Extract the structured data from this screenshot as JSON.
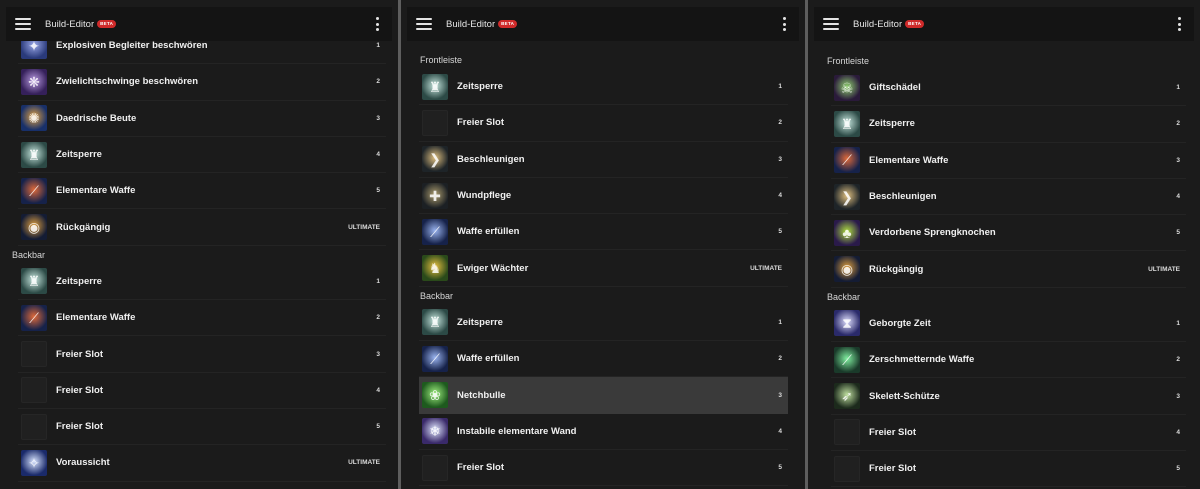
{
  "colors": {
    "background": "#1b1b1b",
    "appbar": "#141414",
    "beta_badge": "#d02a2a",
    "selected_row": "#3a3a3a"
  },
  "panels": [
    {
      "appbar": {
        "title": "Build-Editor",
        "badge": "BETA"
      },
      "sections": [
        {
          "title": "",
          "items": [
            {
              "name": "Explosiven Begleiter beschwören",
              "slot": "1",
              "icon": "explosive-companion-icon",
              "color1": "#2a3a7a",
              "color2": "#9aa8e8",
              "glyph": "✦"
            },
            {
              "name": "Zwielichtschwinge beschwören",
              "slot": "2",
              "icon": "twilight-matriarch-icon",
              "color1": "#35205a",
              "color2": "#b89ae0",
              "glyph": "❋"
            },
            {
              "name": "Daedrische Beute",
              "slot": "3",
              "icon": "daedric-prey-icon",
              "color1": "#18306a",
              "color2": "#e0a040",
              "glyph": "✺"
            },
            {
              "name": "Zeitsperre",
              "slot": "4",
              "icon": "time-stop-icon",
              "color1": "#2c4a46",
              "color2": "#c8e8e0",
              "glyph": "♜"
            },
            {
              "name": "Elementare Waffe",
              "slot": "5",
              "icon": "elemental-weapon-icon",
              "color1": "#16224a",
              "color2": "#e06a3a",
              "glyph": "⟋"
            },
            {
              "name": "Rückgängig",
              "slot": "ULTIMATE",
              "icon": "undo-icon",
              "color1": "#141c34",
              "color2": "#e0a040",
              "glyph": "◉"
            }
          ]
        },
        {
          "title": "Backbar",
          "items": [
            {
              "name": "Zeitsperre",
              "slot": "1",
              "icon": "time-stop-icon",
              "color1": "#2c4a46",
              "color2": "#c8e8e0",
              "glyph": "♜"
            },
            {
              "name": "Elementare Waffe",
              "slot": "2",
              "icon": "elemental-weapon-icon",
              "color1": "#16224a",
              "color2": "#e06a3a",
              "glyph": "⟋"
            },
            {
              "name": "Freier Slot",
              "slot": "3",
              "icon": "empty-slot-icon",
              "empty": true
            },
            {
              "name": "Freier Slot",
              "slot": "4",
              "icon": "empty-slot-icon",
              "empty": true
            },
            {
              "name": "Freier Slot",
              "slot": "5",
              "icon": "empty-slot-icon",
              "empty": true
            },
            {
              "name": "Voraussicht",
              "slot": "ULTIMATE",
              "icon": "foresight-icon",
              "color1": "#1a2a6a",
              "color2": "#d8e4ff",
              "glyph": "✧"
            }
          ]
        }
      ]
    },
    {
      "appbar": {
        "title": "Build-Editor",
        "badge": "BETA"
      },
      "sections": [
        {
          "title": "Frontleiste",
          "items": [
            {
              "name": "Zeitsperre",
              "slot": "1",
              "icon": "time-stop-icon",
              "color1": "#2c4a46",
              "color2": "#c8e8e0",
              "glyph": "♜"
            },
            {
              "name": "Freier Slot",
              "slot": "2",
              "icon": "empty-slot-icon",
              "empty": true
            },
            {
              "name": "Beschleunigen",
              "slot": "3",
              "icon": "accelerate-icon",
              "color1": "#1e2428",
              "color2": "#e0c080",
              "glyph": "❯"
            },
            {
              "name": "Wundpflege",
              "slot": "4",
              "icon": "mend-wounds-icon",
              "color1": "#1c2024",
              "color2": "#b0a070",
              "glyph": "✚"
            },
            {
              "name": "Waffe erfüllen",
              "slot": "5",
              "icon": "imbue-weapon-icon",
              "color1": "#16224a",
              "color2": "#9ab4f0",
              "glyph": "⟋"
            },
            {
              "name": "Ewiger Wächter",
              "slot": "ULTIMATE",
              "icon": "eternal-guardian-icon",
              "color1": "#2a4a1a",
              "color2": "#e8c040",
              "glyph": "♞"
            }
          ]
        },
        {
          "title": "Backbar",
          "items": [
            {
              "name": "Zeitsperre",
              "slot": "1",
              "icon": "time-stop-icon",
              "color1": "#2c4a46",
              "color2": "#c8e8e0",
              "glyph": "♜"
            },
            {
              "name": "Waffe erfüllen",
              "slot": "2",
              "icon": "imbue-weapon-icon",
              "color1": "#16224a",
              "color2": "#9ab4f0",
              "glyph": "⟋"
            },
            {
              "name": "Netchbulle",
              "slot": "3",
              "icon": "bull-netch-icon",
              "color1": "#1e5a1e",
              "color2": "#a0f080",
              "glyph": "❀",
              "selected": true
            },
            {
              "name": "Instabile elementare Wand",
              "slot": "4",
              "icon": "unstable-wall-icon",
              "color1": "#3a2a6a",
              "color2": "#e0e8ff",
              "glyph": "❄"
            },
            {
              "name": "Freier Slot",
              "slot": "5",
              "icon": "empty-slot-icon",
              "empty": true
            }
          ]
        }
      ]
    },
    {
      "appbar": {
        "title": "Build-Editor",
        "badge": "BETA"
      },
      "sections": [
        {
          "title": "Frontleiste",
          "items": [
            {
              "name": "Giftschädel",
              "slot": "1",
              "icon": "venom-skull-icon",
              "color1": "#2a1a3a",
              "color2": "#90d070",
              "glyph": "☠"
            },
            {
              "name": "Zeitsperre",
              "slot": "2",
              "icon": "time-stop-icon",
              "color1": "#2c4a46",
              "color2": "#c8e8e0",
              "glyph": "♜"
            },
            {
              "name": "Elementare Waffe",
              "slot": "3",
              "icon": "elemental-weapon-icon",
              "color1": "#16224a",
              "color2": "#e06a3a",
              "glyph": "⟋"
            },
            {
              "name": "Beschleunigen",
              "slot": "4",
              "icon": "accelerate-icon",
              "color1": "#1e2428",
              "color2": "#e0c080",
              "glyph": "❯"
            },
            {
              "name": "Verdorbene Sprengknochen",
              "slot": "5",
              "icon": "blighted-blastbones-icon",
              "color1": "#2a1a4a",
              "color2": "#b0e040",
              "glyph": "♣"
            },
            {
              "name": "Rückgängig",
              "slot": "ULTIMATE",
              "icon": "undo-icon",
              "color1": "#141c34",
              "color2": "#e0a040",
              "glyph": "◉"
            }
          ]
        },
        {
          "title": "Backbar",
          "items": [
            {
              "name": "Geborgte Zeit",
              "slot": "1",
              "icon": "borrowed-time-icon",
              "color1": "#2a2a6a",
              "color2": "#e0e0ff",
              "glyph": "⧗"
            },
            {
              "name": "Zerschmetternde Waffe",
              "slot": "2",
              "icon": "crushing-weapon-icon",
              "color1": "#1a3a2a",
              "color2": "#80f0a0",
              "glyph": "⟋"
            },
            {
              "name": "Skelett-Schütze",
              "slot": "3",
              "icon": "skeletal-archer-icon",
              "color1": "#1c2a1c",
              "color2": "#c0e0a0",
              "glyph": "➶"
            },
            {
              "name": "Freier Slot",
              "slot": "4",
              "icon": "empty-slot-icon",
              "empty": true
            },
            {
              "name": "Freier Slot",
              "slot": "5",
              "icon": "empty-slot-icon",
              "empty": true
            }
          ]
        }
      ]
    }
  ]
}
